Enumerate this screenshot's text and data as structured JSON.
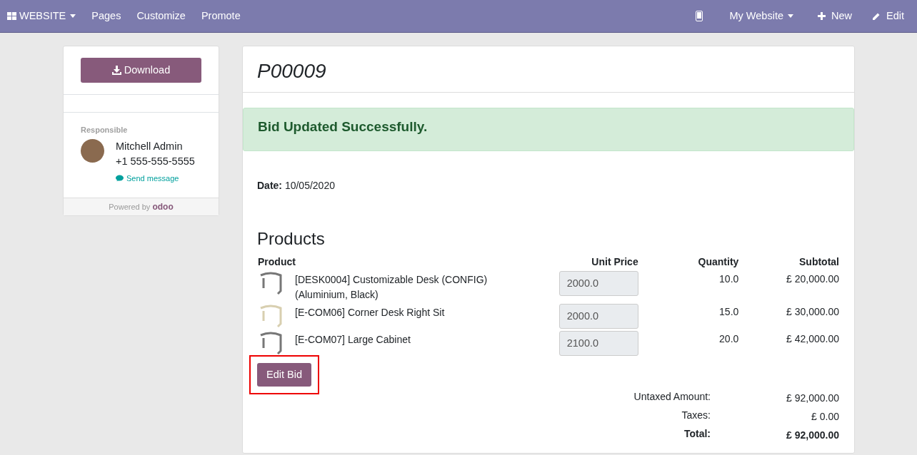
{
  "navbar": {
    "brand": "WEBSITE",
    "menu": [
      "Pages",
      "Customize",
      "Promote"
    ],
    "website_menu": "My Website",
    "new_label": "New",
    "edit_label": "Edit"
  },
  "sidebar": {
    "download_label": "Download",
    "responsible_label": "Responsible",
    "person_name": "Mitchell Admin",
    "phone": "+1 555-555-5555",
    "send_message": "Send message",
    "powered_by": "Powered by",
    "powered_brand": "odoo"
  },
  "document": {
    "title": "P00009",
    "alert": "Bid Updated Successfully.",
    "date_label": "Date:",
    "date": "10/05/2020",
    "section_title": "Products",
    "columns": [
      "Product",
      "Unit Price",
      "Quantity",
      "Subtotal"
    ],
    "rows": [
      {
        "product": "[DESK0004] Customizable Desk (CONFIG) (Aluminium, Black)",
        "unit_price": "2000.0",
        "quantity": "10.0",
        "subtotal": "£ 20,000.00"
      },
      {
        "product": "[E-COM06] Corner Desk Right Sit",
        "unit_price": "2000.0",
        "quantity": "15.0",
        "subtotal": "£ 30,000.00"
      },
      {
        "product": "[E-COM07] Large Cabinet",
        "unit_price": "2100.0",
        "quantity": "20.0",
        "subtotal": "£ 42,000.00"
      }
    ],
    "edit_button": {
      "label": "Edit Bid",
      "highlighted": true
    },
    "totals": [
      {
        "label": "Untaxed Amount:",
        "value": "£ 92,000.00",
        "bold": false
      },
      {
        "label": "Taxes:",
        "value": "£ 0.00",
        "bold": false
      },
      {
        "label": "Total:",
        "value": "£ 92,000.00",
        "bold": true
      }
    ]
  }
}
